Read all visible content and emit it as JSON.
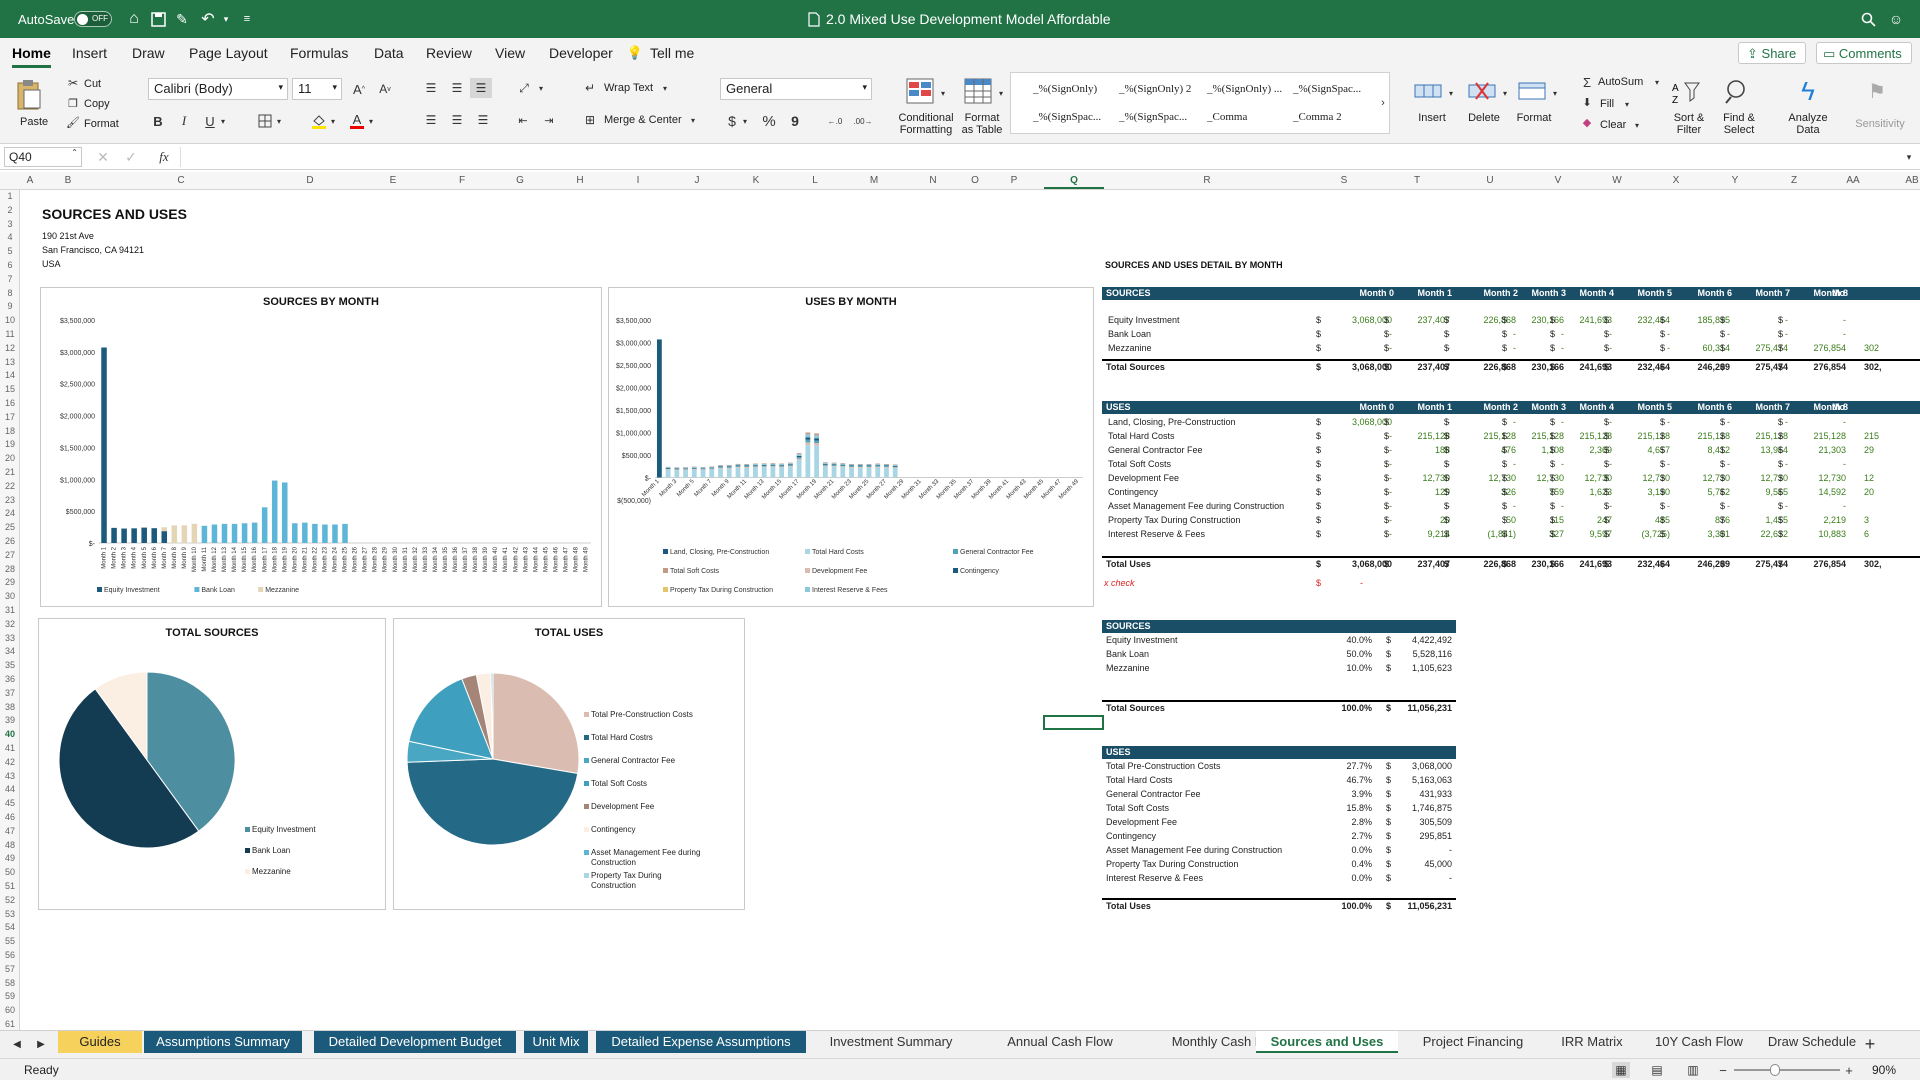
{
  "title_bar": {
    "autosave_label": "AutoSave",
    "autosave_state": "OFF",
    "doc_title": "2.0 Mixed Use Development Model Affordable"
  },
  "ribbon_tabs": [
    "Home",
    "Insert",
    "Draw",
    "Page Layout",
    "Formulas",
    "Data",
    "Review",
    "View",
    "Developer"
  ],
  "tell_me": "Tell me",
  "share_label": "Share",
  "comments_label": "Comments",
  "clipboard": {
    "paste": "Paste",
    "cut": "Cut",
    "copy": "Copy",
    "format": "Format"
  },
  "font": {
    "name": "Calibri (Body)",
    "size": "11"
  },
  "alignment": {
    "wrap": "Wrap Text",
    "merge": "Merge & Center"
  },
  "number_format": "General",
  "styles": {
    "conditional": [
      "Conditional",
      "Formatting"
    ],
    "format_table": [
      "Format",
      "as Table"
    ],
    "cells": [
      "_%(SignOnly)",
      "_%(SignOnly) 2",
      "_%(SignOnly) ...",
      "_%(SignSpac...",
      "_%(SignSpac...",
      "_%(SignSpac...",
      "_Comma",
      "_Comma 2"
    ]
  },
  "cells_group": {
    "insert": "Insert",
    "delete": "Delete",
    "format": "Format"
  },
  "editing": {
    "autosum": "AutoSum",
    "fill": "Fill",
    "clear": "Clear",
    "sort": [
      "Sort &",
      "Filter"
    ],
    "find": [
      "Find &",
      "Select"
    ],
    "analyze": [
      "Analyze",
      "Data"
    ],
    "sensitivity": "Sensitivity"
  },
  "formula_bar": {
    "name_box": "Q40",
    "fx": "fx",
    "formula": ""
  },
  "columns": [
    "A",
    "B",
    "C",
    "D",
    "E",
    "F",
    "G",
    "H",
    "I",
    "J",
    "K",
    "L",
    "M",
    "N",
    "O",
    "P",
    "Q",
    "R",
    "S",
    "T",
    "U",
    "V",
    "W",
    "X",
    "Y",
    "Z",
    "AA",
    "AB"
  ],
  "rows": [
    "1",
    "2",
    "3",
    "4",
    "5",
    "6",
    "7",
    "8",
    "9",
    "10",
    "11",
    "12",
    "13",
    "14",
    "15",
    "16",
    "17",
    "18",
    "19",
    "20",
    "21",
    "22",
    "23",
    "24",
    "25",
    "26",
    "27",
    "28",
    "29",
    "30",
    "31",
    "32",
    "33",
    "34",
    "35",
    "36",
    "37",
    "38",
    "39",
    "40",
    "41",
    "42",
    "43",
    "44",
    "45",
    "46",
    "47",
    "48",
    "49",
    "50",
    "51",
    "52",
    "53",
    "54",
    "55",
    "56",
    "57",
    "58",
    "59",
    "60",
    "61"
  ],
  "sheet": {
    "title": "SOURCES AND USES",
    "address": [
      "190 21st Ave",
      "San Francisco, CA 94121",
      "USA"
    ],
    "detail_title": "SOURCES AND USES DETAIL BY MONTH",
    "check_label": "x check",
    "check_dollar": "$",
    "check_value": "-"
  },
  "colors": {
    "excel_green": "#217346",
    "dark_navy": "#133b52",
    "teal": "#4e8ea1",
    "light_blue": "#5db6d8",
    "tan": "#e3d5b6",
    "peach": "#fbeee2",
    "pink": "#dbbcb0",
    "brown": "#c29a87",
    "header_navy": "#1a4d66"
  },
  "chart_data": [
    {
      "type": "bar",
      "title": "SOURCES BY MONTH",
      "stacked": true,
      "categories": [
        "Month 1",
        "Month 2",
        "Month 3",
        "Month 4",
        "Month 5",
        "Month 6",
        "Month 7",
        "Month 8",
        "Month 9",
        "Month 10",
        "Month 11",
        "Month 12",
        "Month 13",
        "Month 14",
        "Month 15",
        "Month 16",
        "Month 17",
        "Month 18",
        "Month 19",
        "Month 20",
        "Month 21",
        "Month 22",
        "Month 23",
        "Month 24",
        "Month 25",
        "Month 26",
        "Month 27",
        "Month 28",
        "Month 29",
        "Month 30",
        "Month 31",
        "Month 32",
        "Month 33",
        "Month 34",
        "Month 35",
        "Month 36",
        "Month 37",
        "Month 38",
        "Month 39",
        "Month 40",
        "Month 41",
        "Month 42",
        "Month 43",
        "Month 44",
        "Month 45",
        "Month 46",
        "Month 47",
        "Month 48",
        "Month 49"
      ],
      "yticks": [
        "$3,500,000",
        "$3,000,000",
        "$2,500,000",
        "$2,000,000",
        "$1,500,000",
        "$1,000,000",
        "$500,000",
        "$-"
      ],
      "ylim": [
        0,
        3500000
      ],
      "legend_position": "bottom",
      "series": [
        {
          "name": "Equity Investment",
          "color": "#1b5a7a",
          "values": [
            3068000,
            237407,
            226868,
            230166,
            241693,
            232464,
            185895,
            0,
            0,
            0,
            0,
            0,
            0,
            0,
            0,
            0,
            0,
            0,
            0,
            0,
            0,
            0,
            0,
            0,
            0,
            0,
            0,
            0,
            0,
            0,
            0,
            0,
            0,
            0,
            0,
            0,
            0,
            0,
            0,
            0,
            0,
            0,
            0,
            0,
            0,
            0,
            0,
            0,
            0
          ]
        },
        {
          "name": "Bank Loan",
          "color": "#5db6d8",
          "values": [
            0,
            0,
            0,
            0,
            0,
            0,
            0,
            0,
            0,
            0,
            270000,
            290000,
            300000,
            300000,
            310000,
            320000,
            560000,
            980000,
            950000,
            310000,
            320000,
            300000,
            290000,
            290000,
            300000,
            0,
            0,
            0,
            0,
            0,
            0,
            0,
            0,
            0,
            0,
            0,
            0,
            0,
            0,
            0,
            0,
            0,
            0,
            0,
            0,
            0,
            0,
            0,
            0
          ]
        },
        {
          "name": "Mezzanine",
          "color": "#e3d5b6",
          "values": [
            0,
            0,
            0,
            0,
            0,
            0,
            60314,
            275474,
            276854,
            302000,
            0,
            0,
            0,
            0,
            0,
            0,
            0,
            0,
            0,
            0,
            0,
            0,
            0,
            0,
            0,
            0,
            0,
            0,
            0,
            0,
            0,
            0,
            0,
            0,
            0,
            0,
            0,
            0,
            0,
            0,
            0,
            0,
            0,
            0,
            0,
            0,
            0,
            0,
            0
          ]
        }
      ]
    },
    {
      "type": "bar",
      "title": "USES BY MONTH",
      "stacked": true,
      "categories": [
        "Month 1",
        "Month 3",
        "Month 5",
        "Month 7",
        "Month 9",
        "Month 11",
        "Month 13",
        "Month 15",
        "Month 17",
        "Month 19",
        "Month 21",
        "Month 23",
        "Month 25",
        "Month 27",
        "Month 29",
        "Month 31",
        "Month 33",
        "Month 35",
        "Month 37",
        "Month 39",
        "Month 41",
        "Month 43",
        "Month 45",
        "Month 47",
        "Month 49"
      ],
      "yticks": [
        "$3,500,000",
        "$3,000,000",
        "$2,500,000",
        "$2,000,000",
        "$1,500,000",
        "$1,000,000",
        "$500,000",
        "$-",
        "$(500,000)"
      ],
      "ylim": [
        -500000,
        3500000
      ],
      "legend_position": "bottom",
      "series": [
        {
          "name": "Land, Closing, Pre-Construction",
          "color": "#1b5a7a"
        },
        {
          "name": "Total Hard Costs",
          "color": "#a9d6e5"
        },
        {
          "name": "General Contractor Fee",
          "color": "#4fa3b8"
        },
        {
          "name": "Total Soft Costs",
          "color": "#c29a87"
        },
        {
          "name": "Development Fee",
          "color": "#dbbcb0"
        },
        {
          "name": "Contingency",
          "color": "#1b5a7a"
        },
        {
          "name": "Property Tax During Construction",
          "color": "#e3c46a"
        },
        {
          "name": "Interest Reserve & Fees",
          "color": "#8cc8dc"
        }
      ],
      "totals": [
        3068000,
        237407,
        226868,
        230166,
        241693,
        232464,
        246209,
        275474,
        276854,
        302000,
        300000,
        310000,
        315000,
        320000,
        310000,
        330000,
        540000,
        1000000,
        980000,
        340000,
        330000,
        320000,
        300000,
        300000,
        300000,
        310000,
        300000,
        290000,
        0,
        0,
        0,
        0,
        0,
        0,
        0,
        0,
        0,
        0,
        0,
        0,
        0,
        0,
        0,
        0,
        0,
        0,
        0,
        0,
        0
      ]
    },
    {
      "type": "pie",
      "title": "TOTAL SOURCES",
      "legend_position": "right",
      "slices": [
        {
          "name": "Equity Investment",
          "value": 40.0,
          "color": "#4e8ea1"
        },
        {
          "name": "Bank Loan",
          "value": 50.0,
          "color": "#133b52"
        },
        {
          "name": "Mezzanine",
          "value": 10.0,
          "color": "#fbeee2"
        }
      ]
    },
    {
      "type": "pie",
      "title": "TOTAL USES",
      "legend_position": "right",
      "slices": [
        {
          "name": "Total Pre-Construction Costs",
          "value": 27.7,
          "color": "#dbbcb0"
        },
        {
          "name": "Total Hard Costrs",
          "value": 46.7,
          "color": "#246a87"
        },
        {
          "name": "General Contractor Fee",
          "value": 3.9,
          "color": "#49a7c4"
        },
        {
          "name": "Total Soft Costs",
          "value": 15.8,
          "color": "#3f9fbf"
        },
        {
          "name": "Development Fee",
          "value": 2.8,
          "color": "#a58577"
        },
        {
          "name": "Contingency",
          "value": 2.7,
          "color": "#fbeee2"
        },
        {
          "name": "Asset Management Fee during Construction",
          "value": 0.0,
          "color": "#5db6d8"
        },
        {
          "name": "Property Tax During Construction",
          "value": 0.4,
          "color": "#a9d6e5"
        }
      ]
    }
  ],
  "detail": {
    "months": [
      "Month 0",
      "Month 1",
      "Month 2",
      "Month 3",
      "Month 4",
      "Month 5",
      "Month 6",
      "Month 7",
      "Month 8",
      "Mo"
    ],
    "sources_header": "SOURCES",
    "sources": [
      {
        "label": "Equity Investment",
        "values": [
          "3,068,000",
          "237,407",
          "226,868",
          "230,166",
          "241,693",
          "232,464",
          "185,895",
          "-",
          "-",
          ""
        ]
      },
      {
        "label": "Bank Loan",
        "values": [
          "-",
          "-",
          "-",
          "-",
          "-",
          "-",
          "-",
          "-",
          "-",
          ""
        ]
      },
      {
        "label": "Mezzanine",
        "values": [
          "-",
          "-",
          "-",
          "-",
          "-",
          "-",
          "60,314",
          "275,474",
          "276,854",
          "302"
        ]
      }
    ],
    "total_sources": {
      "label": "Total Sources",
      "values": [
        "3,068,000",
        "237,407",
        "226,868",
        "230,166",
        "241,693",
        "232,464",
        "246,209",
        "275,474",
        "276,854",
        "302,"
      ]
    },
    "uses_header": "USES",
    "uses": [
      {
        "label": "Land, Closing, Pre-Construction",
        "values": [
          "3,068,000",
          "-",
          "-",
          "-",
          "-",
          "-",
          "-",
          "-",
          "-",
          ""
        ]
      },
      {
        "label": "Total Hard Costs",
        "values": [
          "-",
          "215,128",
          "215,128",
          "215,128",
          "215,128",
          "215,128",
          "215,128",
          "215,128",
          "215,128",
          "215"
        ]
      },
      {
        "label": "General Contractor Fee",
        "values": [
          "-",
          "188",
          "476",
          "1,108",
          "2,369",
          "4,657",
          "8,412",
          "13,964",
          "21,303",
          "29"
        ]
      },
      {
        "label": "Total Soft Costs",
        "values": [
          "-",
          "-",
          "-",
          "-",
          "-",
          "-",
          "-",
          "-",
          "-",
          ""
        ]
      },
      {
        "label": "Development Fee",
        "values": [
          "-",
          "12,730",
          "12,730",
          "12,730",
          "12,730",
          "12,730",
          "12,730",
          "12,730",
          "12,730",
          "12"
        ]
      },
      {
        "label": "Contingency",
        "values": [
          "-",
          "129",
          "326",
          "759",
          "1,623",
          "3,190",
          "5,762",
          "9,565",
          "14,592",
          "20"
        ]
      },
      {
        "label": "Asset Management Fee during Construction",
        "values": [
          "-",
          "-",
          "-",
          "-",
          "-",
          "-",
          "-",
          "-",
          "-",
          ""
        ]
      },
      {
        "label": "Property Tax During Construction",
        "values": [
          "-",
          "20",
          "50",
          "115",
          "247",
          "485",
          "876",
          "1,455",
          "2,219",
          "3"
        ]
      },
      {
        "label": "Interest Reserve & Fees",
        "values": [
          "-",
          "9,214",
          "(1,841)",
          "327",
          "9,597",
          "(3,725)",
          "3,301",
          "22,632",
          "10,883",
          "6"
        ]
      }
    ],
    "total_uses": {
      "label": "Total Uses",
      "values": [
        "3,068,000",
        "237,407",
        "226,868",
        "230,166",
        "241,693",
        "232,464",
        "246,209",
        "275,474",
        "276,854",
        "302,"
      ]
    }
  },
  "summary": {
    "sources_header": "SOURCES",
    "sources": [
      {
        "label": "Equity Investment",
        "pct": "40.0%",
        "value": "4,422,492"
      },
      {
        "label": "Bank Loan",
        "pct": "50.0%",
        "value": "5,528,116"
      },
      {
        "label": "Mezzanine",
        "pct": "10.0%",
        "value": "1,105,623"
      }
    ],
    "total_sources": {
      "label": "Total Sources",
      "pct": "100.0%",
      "value": "11,056,231"
    },
    "uses_header": "USES",
    "uses": [
      {
        "label": "Total Pre-Construction Costs",
        "pct": "27.7%",
        "value": "3,068,000"
      },
      {
        "label": "Total Hard Costs",
        "pct": "46.7%",
        "value": "5,163,063"
      },
      {
        "label": "General Contractor Fee",
        "pct": "3.9%",
        "value": "431,933"
      },
      {
        "label": "Total Soft Costs",
        "pct": "15.8%",
        "value": "1,746,875"
      },
      {
        "label": "Development Fee",
        "pct": "2.8%",
        "value": "305,509"
      },
      {
        "label": "Contingency",
        "pct": "2.7%",
        "value": "295,851"
      },
      {
        "label": "Asset Management Fee during Construction",
        "pct": "0.0%",
        "value": "-"
      },
      {
        "label": "Property Tax During Construction",
        "pct": "0.4%",
        "value": "45,000"
      },
      {
        "label": "Interest Reserve & Fees",
        "pct": "0.0%",
        "value": "-"
      }
    ],
    "total_uses": {
      "label": "Total Uses",
      "pct": "100.0%",
      "value": "11,056,231"
    }
  },
  "sheet_tabs": [
    {
      "label": "Guides",
      "style": "gold"
    },
    {
      "label": "Assumptions Summary",
      "style": "blue"
    },
    {
      "label": "Detailed Development Budget",
      "style": "blue"
    },
    {
      "label": "Unit Mix",
      "style": "blue"
    },
    {
      "label": "Detailed Expense Assumptions",
      "style": "blue"
    },
    {
      "label": "Investment Summary",
      "style": "plain"
    },
    {
      "label": "Annual Cash Flow",
      "style": "plain"
    },
    {
      "label": "Monthly Cash Flow",
      "style": "plain"
    },
    {
      "label": "Sources and Uses",
      "style": "active"
    },
    {
      "label": "Project Financing",
      "style": "plain"
    },
    {
      "label": "IRR Matrix",
      "style": "plain"
    },
    {
      "label": "10Y Cash Flow",
      "style": "plain"
    },
    {
      "label": "Draw Schedule",
      "style": "plain"
    }
  ],
  "status": {
    "ready": "Ready",
    "zoom": "90%"
  },
  "dollar": "$"
}
